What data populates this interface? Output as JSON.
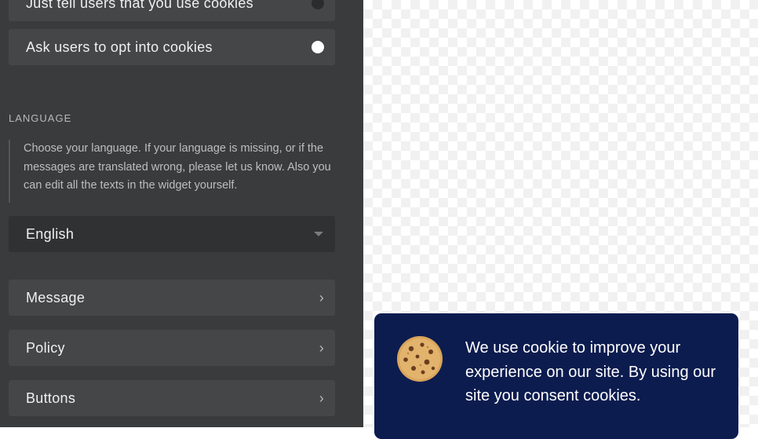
{
  "sidebar": {
    "options": [
      {
        "label": "Just tell users that you use cookies",
        "selected": false
      },
      {
        "label": "Ask users to opt into cookies",
        "selected": true
      }
    ],
    "language": {
      "section_title": "LANGUAGE",
      "hint": "Choose your language. If your language is missing, or if the messages are translated wrong, please let us know. Also you can edit all the texts in the widget yourself.",
      "selected": "English",
      "dropdown_icon": "caret-down-icon"
    },
    "menu": [
      {
        "label": "Message",
        "icon": "chevron-right-icon"
      },
      {
        "label": "Policy",
        "icon": "chevron-right-icon"
      },
      {
        "label": "Buttons",
        "icon": "chevron-right-icon"
      }
    ]
  },
  "preview": {
    "banner": {
      "icon": "cookie-icon",
      "message": "We use cookie to improve your experience on our site. By using our site you consent cookies.",
      "background": "#0c1c4f"
    }
  }
}
